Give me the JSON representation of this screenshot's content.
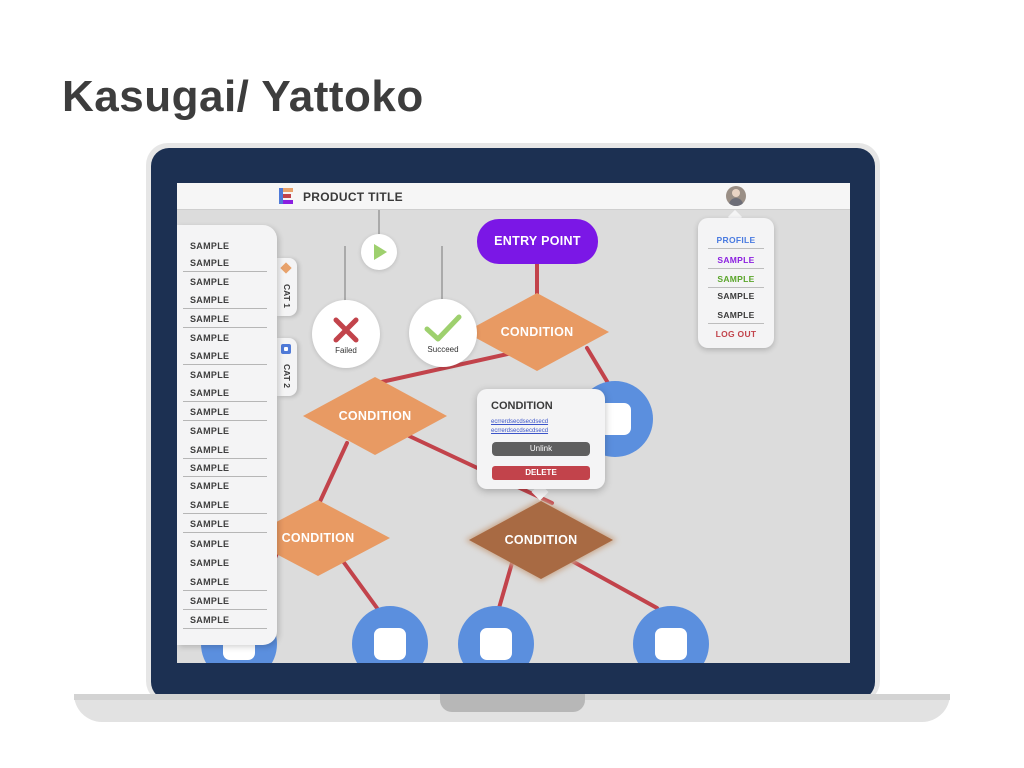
{
  "page": {
    "heading": "Kasugai/ Yattoko"
  },
  "app": {
    "product_title": "PRODUCT TITLE",
    "entry_point": "ENTRY POINT",
    "conditions": [
      "CONDITION",
      "CONDITION",
      "CONDITION",
      "CONDITION"
    ],
    "actions": {
      "failed": "Failed",
      "succeed": "Succeed"
    },
    "colors": {
      "entry": "#7b17e6",
      "condition": "#e89a63",
      "condition_selected": "#a86a43",
      "edge": "#c2434b",
      "node": "#5b8fde",
      "bezel": "#1c3052"
    }
  },
  "sidebar": {
    "items": [
      "SAMPLE",
      "SAMPLE",
      "SAMPLE",
      "SAMPLE",
      "SAMPLE",
      "SAMPLE",
      "SAMPLE",
      "SAMPLE",
      "SAMPLE",
      "SAMPLE",
      "SAMPLE",
      "SAMPLE",
      "SAMPLE",
      "SAMPLE",
      "SAMPLE",
      "SAMPLE",
      "SAMPLE",
      "SAMPLE",
      "SAMPLE",
      "SAMPLE",
      "SAMPLE",
      "SAMPLE"
    ],
    "tabs": [
      "CAT 1",
      "CAT 2"
    ]
  },
  "popover": {
    "title": "CONDITION",
    "links": [
      "ecrrerdsecdsecdsecd",
      "ecrrerdsecdsecdsecd"
    ],
    "unlink_label": "Unlink",
    "delete_label": "DELETE"
  },
  "profile_menu": {
    "items": [
      {
        "label": "PROFILE",
        "color": "#4a7be0"
      },
      {
        "label": "SAMPLE",
        "color": "#8b1fe0"
      },
      {
        "label": "SAMPLE",
        "color": "#5aa52a"
      },
      {
        "label": "SAMPLE",
        "color": "#3a3a3a"
      },
      {
        "label": "SAMPLE",
        "color": "#3a3a3a"
      },
      {
        "label": "LOG OUT",
        "color": "#c2434b"
      }
    ]
  },
  "icons": [
    "logo-icon",
    "play-icon",
    "close-icon",
    "check-icon",
    "avatar"
  ]
}
